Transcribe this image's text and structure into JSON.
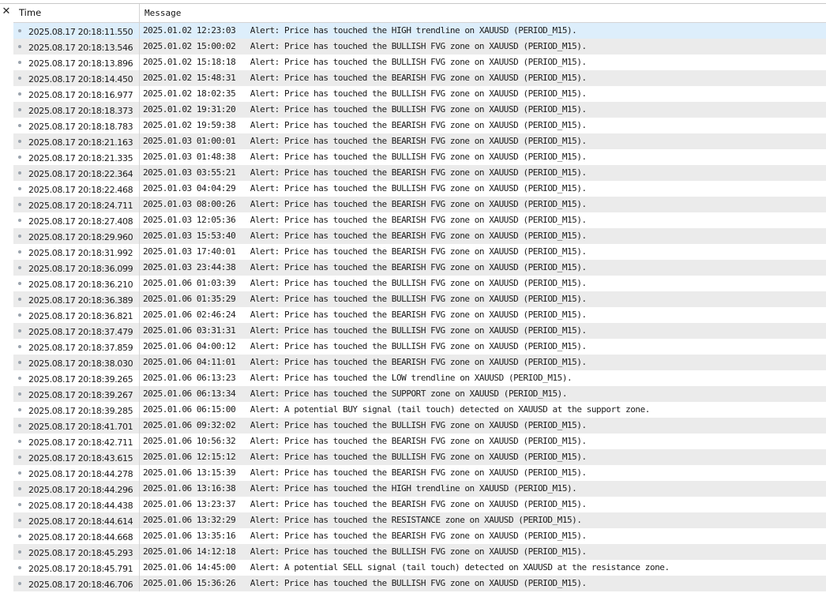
{
  "journal": {
    "close_glyph": "✕",
    "columns": {
      "time": "Time",
      "message": "Message"
    },
    "rows": [
      {
        "time": "2025.08.17 20:18:11.550",
        "message": "2025.01.02 12:23:03   Alert: Price has touched the HIGH trendline on XAUUSD (PERIOD_M15)."
      },
      {
        "time": "2025.08.17 20:18:13.546",
        "message": "2025.01.02 15:00:02   Alert: Price has touched the BULLISH FVG zone on XAUUSD (PERIOD_M15)."
      },
      {
        "time": "2025.08.17 20:18:13.896",
        "message": "2025.01.02 15:18:18   Alert: Price has touched the BULLISH FVG zone on XAUUSD (PERIOD_M15)."
      },
      {
        "time": "2025.08.17 20:18:14.450",
        "message": "2025.01.02 15:48:31   Alert: Price has touched the BEARISH FVG zone on XAUUSD (PERIOD_M15)."
      },
      {
        "time": "2025.08.17 20:18:16.977",
        "message": "2025.01.02 18:02:35   Alert: Price has touched the BULLISH FVG zone on XAUUSD (PERIOD_M15)."
      },
      {
        "time": "2025.08.17 20:18:18.373",
        "message": "2025.01.02 19:31:20   Alert: Price has touched the BULLISH FVG zone on XAUUSD (PERIOD_M15)."
      },
      {
        "time": "2025.08.17 20:18:18.783",
        "message": "2025.01.02 19:59:38   Alert: Price has touched the BEARISH FVG zone on XAUUSD (PERIOD_M15)."
      },
      {
        "time": "2025.08.17 20:18:21.163",
        "message": "2025.01.03 01:00:01   Alert: Price has touched the BEARISH FVG zone on XAUUSD (PERIOD_M15)."
      },
      {
        "time": "2025.08.17 20:18:21.335",
        "message": "2025.01.03 01:48:38   Alert: Price has touched the BULLISH FVG zone on XAUUSD (PERIOD_M15)."
      },
      {
        "time": "2025.08.17 20:18:22.364",
        "message": "2025.01.03 03:55:21   Alert: Price has touched the BEARISH FVG zone on XAUUSD (PERIOD_M15)."
      },
      {
        "time": "2025.08.17 20:18:22.468",
        "message": "2025.01.03 04:04:29   Alert: Price has touched the BULLISH FVG zone on XAUUSD (PERIOD_M15)."
      },
      {
        "time": "2025.08.17 20:18:24.711",
        "message": "2025.01.03 08:00:26   Alert: Price has touched the BEARISH FVG zone on XAUUSD (PERIOD_M15)."
      },
      {
        "time": "2025.08.17 20:18:27.408",
        "message": "2025.01.03 12:05:36   Alert: Price has touched the BEARISH FVG zone on XAUUSD (PERIOD_M15)."
      },
      {
        "time": "2025.08.17 20:18:29.960",
        "message": "2025.01.03 15:53:40   Alert: Price has touched the BEARISH FVG zone on XAUUSD (PERIOD_M15)."
      },
      {
        "time": "2025.08.17 20:18:31.992",
        "message": "2025.01.03 17:40:01   Alert: Price has touched the BEARISH FVG zone on XAUUSD (PERIOD_M15)."
      },
      {
        "time": "2025.08.17 20:18:36.099",
        "message": "2025.01.03 23:44:38   Alert: Price has touched the BEARISH FVG zone on XAUUSD (PERIOD_M15)."
      },
      {
        "time": "2025.08.17 20:18:36.210",
        "message": "2025.01.06 01:03:39   Alert: Price has touched the BULLISH FVG zone on XAUUSD (PERIOD_M15)."
      },
      {
        "time": "2025.08.17 20:18:36.389",
        "message": "2025.01.06 01:35:29   Alert: Price has touched the BULLISH FVG zone on XAUUSD (PERIOD_M15)."
      },
      {
        "time": "2025.08.17 20:18:36.821",
        "message": "2025.01.06 02:46:24   Alert: Price has touched the BEARISH FVG zone on XAUUSD (PERIOD_M15)."
      },
      {
        "time": "2025.08.17 20:18:37.479",
        "message": "2025.01.06 03:31:31   Alert: Price has touched the BULLISH FVG zone on XAUUSD (PERIOD_M15)."
      },
      {
        "time": "2025.08.17 20:18:37.859",
        "message": "2025.01.06 04:00:12   Alert: Price has touched the BULLISH FVG zone on XAUUSD (PERIOD_M15)."
      },
      {
        "time": "2025.08.17 20:18:38.030",
        "message": "2025.01.06 04:11:01   Alert: Price has touched the BEARISH FVG zone on XAUUSD (PERIOD_M15)."
      },
      {
        "time": "2025.08.17 20:18:39.265",
        "message": "2025.01.06 06:13:23   Alert: Price has touched the LOW trendline on XAUUSD (PERIOD_M15)."
      },
      {
        "time": "2025.08.17 20:18:39.267",
        "message": "2025.01.06 06:13:34   Alert: Price has touched the SUPPORT zone on XAUUSD (PERIOD_M15)."
      },
      {
        "time": "2025.08.17 20:18:39.285",
        "message": "2025.01.06 06:15:00   Alert: A potential BUY signal (tail touch) detected on XAUUSD at the support zone."
      },
      {
        "time": "2025.08.17 20:18:41.701",
        "message": "2025.01.06 09:32:02   Alert: Price has touched the BULLISH FVG zone on XAUUSD (PERIOD_M15)."
      },
      {
        "time": "2025.08.17 20:18:42.711",
        "message": "2025.01.06 10:56:32   Alert: Price has touched the BEARISH FVG zone on XAUUSD (PERIOD_M15)."
      },
      {
        "time": "2025.08.17 20:18:43.615",
        "message": "2025.01.06 12:15:12   Alert: Price has touched the BULLISH FVG zone on XAUUSD (PERIOD_M15)."
      },
      {
        "time": "2025.08.17 20:18:44.278",
        "message": "2025.01.06 13:15:39   Alert: Price has touched the BEARISH FVG zone on XAUUSD (PERIOD_M15)."
      },
      {
        "time": "2025.08.17 20:18:44.296",
        "message": "2025.01.06 13:16:38   Alert: Price has touched the HIGH trendline on XAUUSD (PERIOD_M15)."
      },
      {
        "time": "2025.08.17 20:18:44.438",
        "message": "2025.01.06 13:23:37   Alert: Price has touched the BEARISH FVG zone on XAUUSD (PERIOD_M15)."
      },
      {
        "time": "2025.08.17 20:18:44.614",
        "message": "2025.01.06 13:32:29   Alert: Price has touched the RESISTANCE zone on XAUUSD (PERIOD_M15)."
      },
      {
        "time": "2025.08.17 20:18:44.668",
        "message": "2025.01.06 13:35:16   Alert: Price has touched the BEARISH FVG zone on XAUUSD (PERIOD_M15)."
      },
      {
        "time": "2025.08.17 20:18:45.293",
        "message": "2025.01.06 14:12:18   Alert: Price has touched the BULLISH FVG zone on XAUUSD (PERIOD_M15)."
      },
      {
        "time": "2025.08.17 20:18:45.791",
        "message": "2025.01.06 14:45:00   Alert: A potential SELL signal (tail touch) detected on XAUUSD at the resistance zone."
      },
      {
        "time": "2025.08.17 20:18:46.706",
        "message": "2025.01.06 15:36:26   Alert: Price has touched the BULLISH FVG zone on XAUUSD (PERIOD_M15)."
      }
    ]
  }
}
